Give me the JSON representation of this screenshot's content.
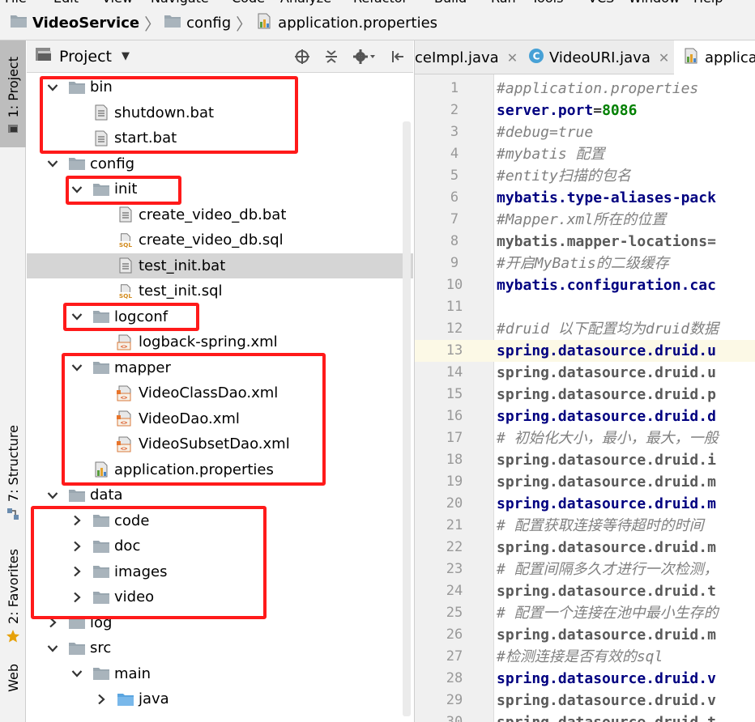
{
  "menu": [
    "File",
    "Edit",
    "View",
    "Navigate",
    "Code",
    "Analyze",
    "Refactor",
    "Build",
    "Run",
    "Tools",
    "VCS",
    "Window",
    "Help"
  ],
  "breadcrumb": [
    {
      "label": "VideoService",
      "bold": true,
      "icon": "folder-icon"
    },
    {
      "label": "config",
      "bold": false,
      "icon": "folder-icon"
    },
    {
      "label": "application.properties",
      "bold": false,
      "icon": "properties-file-icon"
    }
  ],
  "side_tabs": [
    "1: Project",
    "7: Structure",
    "2: Favorites",
    "Web"
  ],
  "project_panel": {
    "title": "Project",
    "tools": [
      "locate-icon",
      "collapse-icon",
      "settings-gear-icon",
      "hide-panel-icon"
    ]
  },
  "tree": [
    {
      "label": "bin",
      "depth": 0,
      "type": "folder",
      "expand": "open"
    },
    {
      "label": "shutdown.bat",
      "depth": 1,
      "type": "text",
      "expand": "none"
    },
    {
      "label": "start.bat",
      "depth": 1,
      "type": "text",
      "expand": "none"
    },
    {
      "label": "config",
      "depth": 0,
      "type": "folder",
      "expand": "open"
    },
    {
      "label": "init",
      "depth": 1,
      "type": "folder",
      "expand": "open"
    },
    {
      "label": "create_video_db.bat",
      "depth": 2,
      "type": "text",
      "expand": "none"
    },
    {
      "label": "create_video_db.sql",
      "depth": 2,
      "type": "sql",
      "expand": "none"
    },
    {
      "label": "test_init.bat",
      "depth": 2,
      "type": "text",
      "expand": "none",
      "selected": true
    },
    {
      "label": "test_init.sql",
      "depth": 2,
      "type": "sql",
      "expand": "none"
    },
    {
      "label": "logconf",
      "depth": 1,
      "type": "folder",
      "expand": "open"
    },
    {
      "label": "logback-spring.xml",
      "depth": 2,
      "type": "xml",
      "expand": "none"
    },
    {
      "label": "mapper",
      "depth": 1,
      "type": "folder",
      "expand": "open"
    },
    {
      "label": "VideoClassDao.xml",
      "depth": 2,
      "type": "xml-mapper",
      "expand": "none"
    },
    {
      "label": "VideoDao.xml",
      "depth": 2,
      "type": "xml-mapper",
      "expand": "none"
    },
    {
      "label": "VideoSubsetDao.xml",
      "depth": 2,
      "type": "xml-mapper",
      "expand": "none"
    },
    {
      "label": "application.properties",
      "depth": 1,
      "type": "properties",
      "expand": "none"
    },
    {
      "label": "data",
      "depth": 0,
      "type": "folder",
      "expand": "open"
    },
    {
      "label": "code",
      "depth": 1,
      "type": "folder",
      "expand": "closed"
    },
    {
      "label": "doc",
      "depth": 1,
      "type": "folder",
      "expand": "closed"
    },
    {
      "label": "images",
      "depth": 1,
      "type": "folder",
      "expand": "closed"
    },
    {
      "label": "video",
      "depth": 1,
      "type": "folder",
      "expand": "closed"
    },
    {
      "label": "log",
      "depth": 0,
      "type": "folder",
      "expand": "closed"
    },
    {
      "label": "src",
      "depth": 0,
      "type": "folder",
      "expand": "open"
    },
    {
      "label": "main",
      "depth": 1,
      "type": "folder",
      "expand": "open"
    },
    {
      "label": "java",
      "depth": 2,
      "type": "folder-source",
      "expand": "closed"
    }
  ],
  "editor_tabs": [
    {
      "label": "ceImpl.java",
      "icon": "none",
      "active": false
    },
    {
      "label": "VideoURI.java",
      "icon": "class-icon",
      "active": false
    },
    {
      "label": "applica",
      "icon": "properties-file-icon",
      "active": true
    }
  ],
  "current_line": 13,
  "code_lines": [
    [
      {
        "t": "#application.properties",
        "c": "comment"
      }
    ],
    [
      {
        "t": "server.port",
        "c": "key"
      },
      {
        "t": "=",
        "c": "eq"
      },
      {
        "t": "8086",
        "c": "val"
      }
    ],
    [
      {
        "t": "#debug=true",
        "c": "comment"
      }
    ],
    [
      {
        "t": "#mybatis 配置",
        "c": "comment"
      }
    ],
    [
      {
        "t": "#entity扫描的包名",
        "c": "comment"
      }
    ],
    [
      {
        "t": "mybatis.type-aliases-pack",
        "c": "key"
      }
    ],
    [
      {
        "t": "#Mapper.xml所在的位置",
        "c": "comment"
      }
    ],
    [
      {
        "t": "mybatis.mapper-locations=",
        "c": "keydim"
      }
    ],
    [
      {
        "t": "#开启MyBatis的二级缓存",
        "c": "comment"
      }
    ],
    [
      {
        "t": "mybatis.configuration.cac",
        "c": "key"
      }
    ],
    [],
    [
      {
        "t": "#druid 以下配置均为druid数据",
        "c": "comment"
      }
    ],
    [
      {
        "t": "spring.datasource.druid.u",
        "c": "key"
      }
    ],
    [
      {
        "t": "spring.datasource.druid.u",
        "c": "keydim"
      }
    ],
    [
      {
        "t": "spring.datasource.druid.p",
        "c": "keydim"
      }
    ],
    [
      {
        "t": "spring.datasource.druid.d",
        "c": "key"
      }
    ],
    [
      {
        "t": "# 初始化大小，最小，最大，一般",
        "c": "comment"
      }
    ],
    [
      {
        "t": "spring.datasource.druid.i",
        "c": "keydim"
      }
    ],
    [
      {
        "t": "spring.datasource.druid.m",
        "c": "keydim"
      }
    ],
    [
      {
        "t": "spring.datasource.druid.m",
        "c": "key"
      }
    ],
    [
      {
        "t": "# 配置获取连接等待超时的时间",
        "c": "comment"
      }
    ],
    [
      {
        "t": "spring.datasource.druid.m",
        "c": "keydim"
      }
    ],
    [
      {
        "t": "# 配置间隔多久才进行一次检测，",
        "c": "comment"
      }
    ],
    [
      {
        "t": "spring.datasource.druid.t",
        "c": "keydim"
      }
    ],
    [
      {
        "t": "# 配置一个连接在池中最小生存的",
        "c": "comment"
      }
    ],
    [
      {
        "t": "spring.datasource.druid.m",
        "c": "keydim"
      }
    ],
    [
      {
        "t": "#检测连接是否有效的sql",
        "c": "comment"
      }
    ],
    [
      {
        "t": "spring.datasource.druid.v",
        "c": "key"
      }
    ],
    [
      {
        "t": "spring.datasource.druid.v",
        "c": "keydim"
      }
    ],
    [
      {
        "t": "spring.datasource.druid.t",
        "c": "keydim"
      }
    ]
  ],
  "colors": {
    "highlight_box": "#ff1a1a",
    "comment": "#808080",
    "key": "#000080",
    "value": "#008000",
    "selection": "#d5d5d5"
  }
}
